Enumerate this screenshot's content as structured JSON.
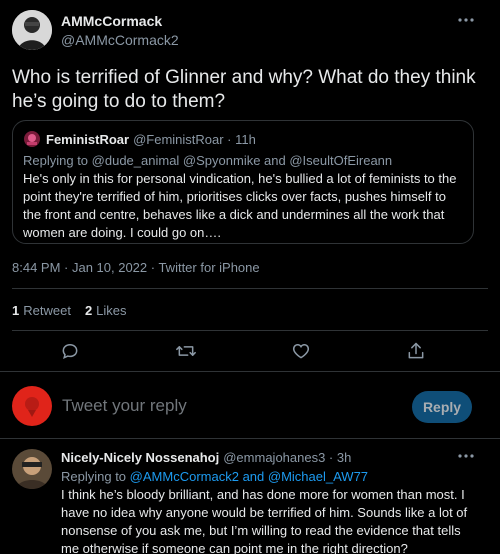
{
  "author": {
    "display_name": "AMMcCormack",
    "handle": "@AMMcCormack2"
  },
  "tweet_text": "Who is terrified of Glinner and why? What do they think he’s going to do to them?",
  "quoted": {
    "display_name": "FeministRoar",
    "handle_time": "@FeministRoar · 11h",
    "reply_prefix": "Replying to",
    "reply_targets": "@dude_animal @Spyonmike and @IseultOfEireann",
    "text": "He's only in this for personal vindication, he's bullied a lot of feminists to the point they're terrified of him, prioritises clicks over facts, pushes himself to the front and centre, behaves like a dick and undermines all the work that women are doing. I could go on…."
  },
  "meta": {
    "timestamp": "8:44 PM · Jan 10, 2022 · Twitter for iPhone"
  },
  "stats": {
    "retweets_count": "1",
    "retweets_label": "Retweet",
    "likes_count": "2",
    "likes_label": "Likes"
  },
  "composer": {
    "placeholder": "Tweet your reply",
    "reply_button": "Reply"
  },
  "reply": {
    "display_name": "Nicely-Nicely Nossenahoj",
    "handle_time": "@emmajohanes3 · 3h",
    "reply_prefix": "Replying to",
    "reply_user1": "@AMMcCormack2",
    "reply_and": "and",
    "reply_user2": "@Michael_AW77",
    "text": "I think he’s bloody brilliant, and has done more for women than most. I have no idea why anyone would be terrified of him. Sounds like a lot of nonsense of you ask me, but I’m willing to read the evidence that tells me otherwise if someone can point me in the right direction?"
  },
  "icons": {
    "more": "more-icon",
    "reply": "reply-icon",
    "retweet": "retweet-icon",
    "like": "heart-icon",
    "share": "share-icon"
  },
  "colors": {
    "background": "#000000",
    "text": "#e7e9ea",
    "muted": "#8b98a5",
    "link": "#1d9bf0",
    "reply_button_bg": "#0f4e78",
    "reply_button_text": "#a9adb1",
    "divider": "#2f3336"
  }
}
